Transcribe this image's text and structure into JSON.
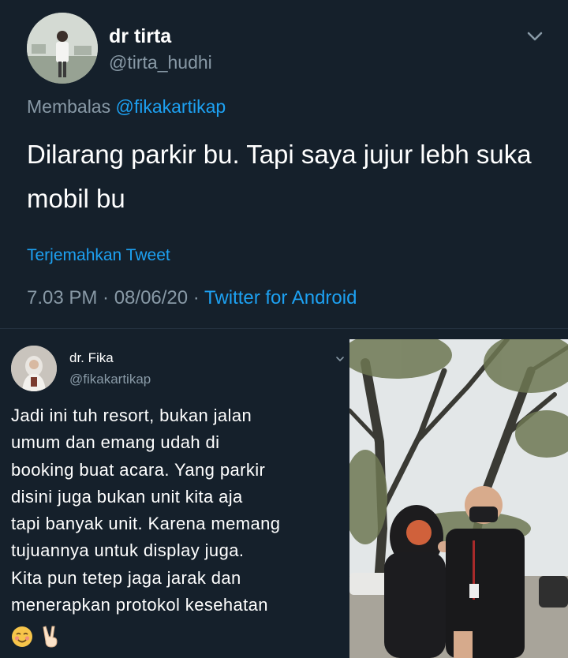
{
  "main_tweet": {
    "author_name": "dr tirta",
    "author_handle": "@tirta_hudhi",
    "reply_prefix": "Membalas ",
    "reply_mention": "@fikakartikap",
    "text": "Dilarang parkir bu.  Tapi saya jujur lebh suka mobil bu",
    "translate_label": "Terjemahkan Tweet",
    "timestamp": "7.03 PM · 08/06/20 · ",
    "source": "Twitter for Android",
    "icons": {
      "menu": "chevron-down-icon"
    }
  },
  "quoted_tweet": {
    "author_name": "dr. Fika",
    "author_handle": "@fikakartikap",
    "lines": [
      "Jadi ini tuh resort, bukan jalan",
      "umum dan emang udah di",
      "booking buat acara. Yang parkir",
      "disini juga bukan unit kita aja",
      "tapi banyak unit. Karena memang",
      "tujuannya untuk display juga.",
      "Kita pun tetep jaga jarak dan",
      "menerapkan protokol kesehatan"
    ],
    "emojis": [
      "smiling-blush-emoji",
      "victory-hand-emoji"
    ]
  },
  "colors": {
    "background": "#15202b",
    "text_primary": "#ffffff",
    "text_secondary": "#8899a6",
    "link": "#1da1f2",
    "divider": "#253341"
  }
}
